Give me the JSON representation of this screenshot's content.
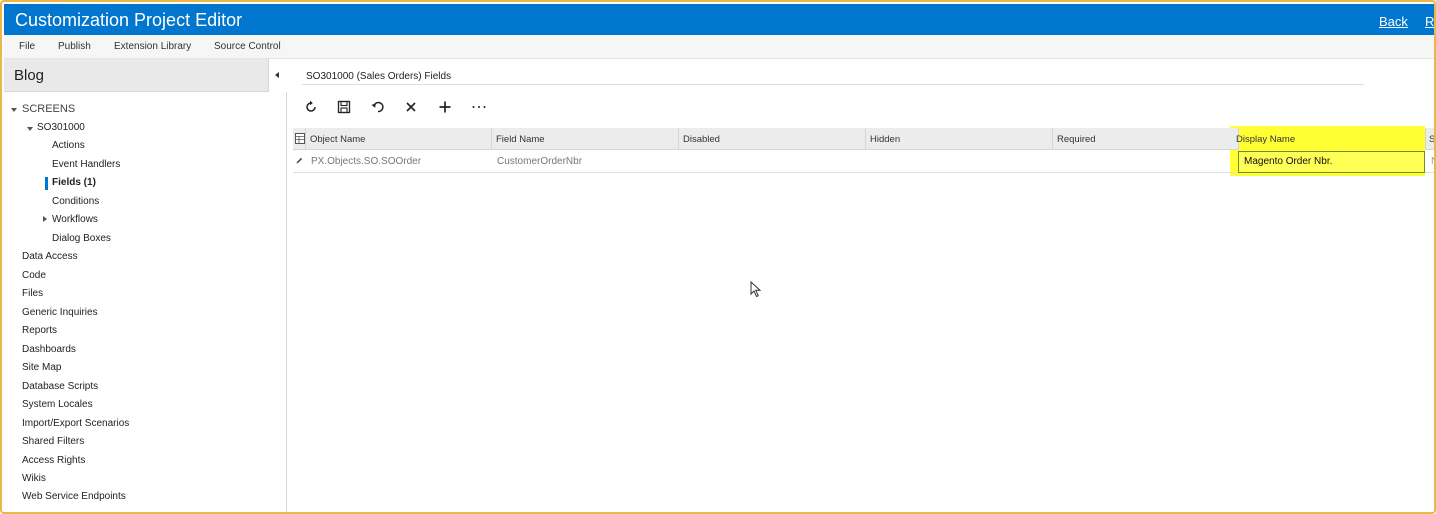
{
  "window": {
    "title": "Customization Project Editor",
    "back_label": "Back",
    "right_cut_label": "R"
  },
  "menu": [
    "File",
    "Publish",
    "Extension Library",
    "Source Control"
  ],
  "sidebar": {
    "project_name": "Blog",
    "tree": {
      "screens_label": "SCREENS",
      "screen_id": "SO301000",
      "screen_children": [
        "Actions",
        "Event Handlers",
        "Fields (1)",
        "Conditions",
        "Workflows",
        "Dialog Boxes"
      ],
      "selected_child": "Fields (1)",
      "top_items": [
        "Data Access",
        "Code",
        "Files",
        "Generic Inquiries",
        "Reports",
        "Dashboards",
        "Site Map",
        "Database Scripts",
        "System Locales",
        "Import/Export Scenarios",
        "Shared Filters",
        "Access Rights",
        "Wikis",
        "Web Service Endpoints"
      ]
    }
  },
  "main": {
    "heading": "SO301000 (Sales Orders) Fields",
    "toolbar_icons": [
      "refresh-icon",
      "save-icon",
      "undo-icon",
      "delete-icon",
      "add-icon",
      "more-icon"
    ],
    "grid": {
      "columns": [
        "Object Name",
        "Field Name",
        "Disabled",
        "Hidden",
        "Required",
        "Display Name",
        "S"
      ],
      "rows": [
        {
          "object_name": "PX.Objects.SO.SOOrder",
          "field_name": "CustomerOrderNbr",
          "disabled": "",
          "hidden": "",
          "required": "",
          "display_name": "Magento Order Nbr.",
          "s": "N"
        }
      ]
    }
  },
  "colors": {
    "accent": "#0076ce",
    "highlight": "#ffff33",
    "frame_border": "#e8b84a"
  }
}
